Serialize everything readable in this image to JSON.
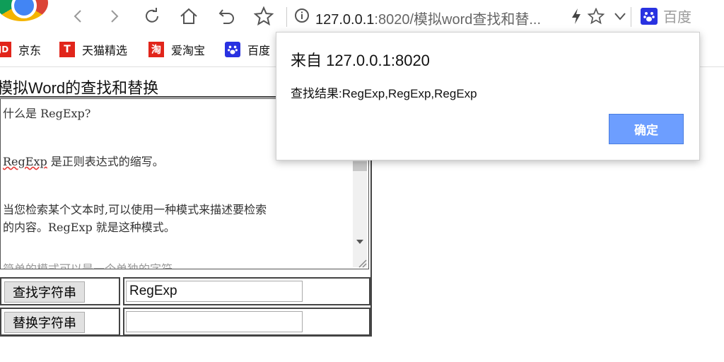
{
  "browser": {
    "url_host": "127.0.0.1",
    "url_rest": ":8020/模拟word查找和替...",
    "search_engine_label": "百度"
  },
  "bookmarks": [
    {
      "label": "京东",
      "icon": "jd-icon",
      "color": "#e1251b",
      "glyph": "JD"
    },
    {
      "label": "天猫精选",
      "icon": "tmall-icon",
      "color": "#e1251b",
      "glyph": "T"
    },
    {
      "label": "爱淘宝",
      "icon": "taobao-icon",
      "color": "#e1251b",
      "glyph": "淘"
    },
    {
      "label": "百度",
      "icon": "baidu-icon",
      "color": "#2932e1",
      "glyph": "🐾"
    }
  ],
  "page": {
    "title": "模拟Word的查找和替换",
    "text_lines": [
      "什么是 RegExp?",
      "",
      "",
      "RegExp 是正则表达式的缩写。",
      "",
      "",
      "当您检索某个文本时,可以使用一种模式来描述要检索",
      "的内容。RegExp 就是这种模式。",
      "",
      "简单的模式可以是一个单独的字符。"
    ],
    "find_button": "查找字符串",
    "find_value": "RegExp",
    "replace_button": "替换字符串",
    "replace_value": ""
  },
  "dialog": {
    "title": "来自 127.0.0.1:8020",
    "message": "查找结果:RegExp,RegExp,RegExp",
    "ok_label": "确定"
  },
  "colors": {
    "dialog_button": "#6d9eff",
    "accent": "#1a73e8"
  }
}
